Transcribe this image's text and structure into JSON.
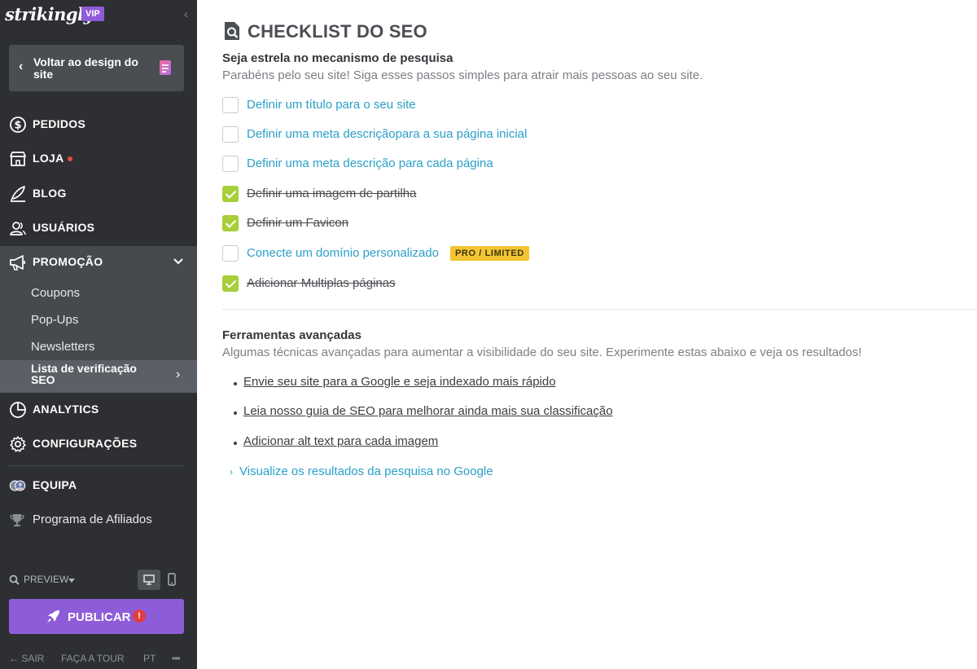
{
  "brand": {
    "logo": "strikingly",
    "badge": "VIP"
  },
  "sidebar": {
    "back_label": "Voltar ao design do site",
    "nav": {
      "pedidos": "PEDIDOS",
      "loja": "LOJA",
      "blog": "BLOG",
      "usuarios": "USUÁRIOS",
      "promocao": "PROMOÇÃO",
      "analytics": "ANALYTICS",
      "configuracoes": "CONFIGURAÇÕES",
      "equipa": "EQUIPA"
    },
    "promo_sub": [
      "Coupons",
      "Pop-Ups",
      "Newsletters",
      "Lista de verificação SEO"
    ],
    "affiliate": "Programa de Afiliados",
    "preview": "PREVIEW",
    "publish": "PUBLICAR",
    "publish_alert": "!",
    "footer": {
      "exit": "SAIR",
      "tour": "FAÇA A TOUR",
      "lang": "PT",
      "more": "•••"
    }
  },
  "main": {
    "title": "CHECKLIST DO SEO",
    "section1_title": "Seja estrela no mecanismo de pesquisa",
    "section1_desc": "Parabéns pelo seu site! Siga esses passos simples para atrair mais pessoas ao seu site.",
    "checklist": [
      {
        "label": "Definir um título para o seu site",
        "done": false
      },
      {
        "label": "Definir uma meta descriçãopara a sua página inicial",
        "done": false
      },
      {
        "label": "Definir uma meta descrição para cada página",
        "done": false
      },
      {
        "label": "Definir uma imagem de partilha",
        "done": true
      },
      {
        "label": "Definir um Favicon",
        "done": true
      },
      {
        "label": "Conecte um domínio personalizado",
        "done": false,
        "badge": "PRO / LIMITED"
      },
      {
        "label": "Adicionar Multiplas páginas",
        "done": true
      }
    ],
    "section2_title": "Ferramentas avançadas",
    "section2_desc": "Algumas técnicas avançadas para aumentar a visibilidade do seu site. Experimente estas abaixo e veja os resultados!",
    "advanced_links": [
      "Envie seu site para a Google e seja indexado mais rápido",
      "Leia nosso guia de SEO para melhorar ainda mais sua classificação",
      "Adicionar alt text para cada imagem"
    ],
    "google_preview": "Visualize os resultados da pesquisa no Google"
  },
  "colors": {
    "sidebar_bg": "#2d2f32",
    "accent_purple": "#8e5cd9",
    "link_blue": "#2aa0c8",
    "check_green": "#a6cf3a",
    "badge_yellow": "#f3c531"
  }
}
